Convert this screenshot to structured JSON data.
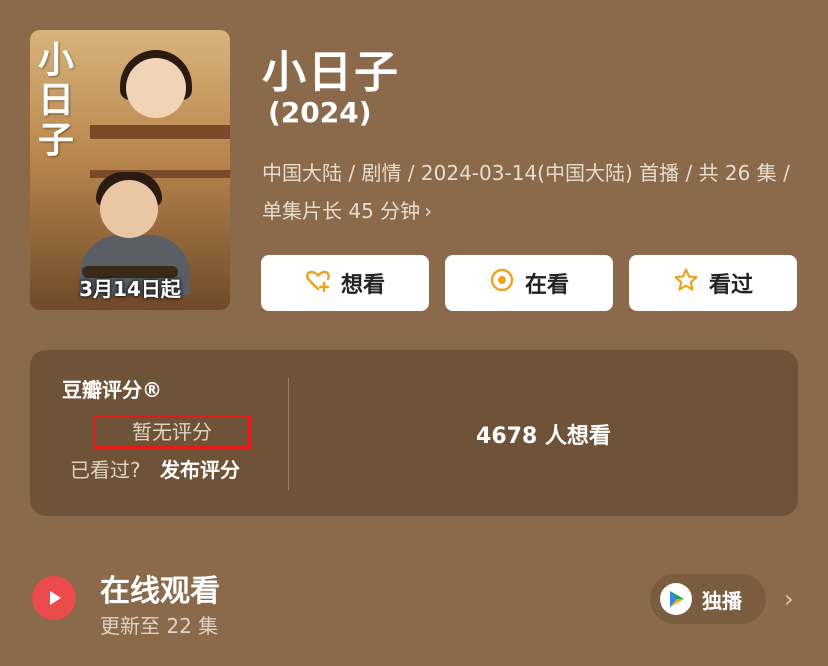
{
  "poster": {
    "calligraphy": "小日子",
    "date_text": "3月14日起"
  },
  "header": {
    "title": "小日子",
    "year": "(2024)",
    "meta_line": "中国大陆 / 剧情 / 2024-03-14(中国大陆) 首播 / 共 26 集 / 单集片长 45 分钟",
    "meta_chevron": "›"
  },
  "actions": [
    {
      "label": "想看",
      "icon": "heart-plus-icon"
    },
    {
      "label": "在看",
      "icon": "target-icon"
    },
    {
      "label": "看过",
      "icon": "star-icon"
    }
  ],
  "rating": {
    "label": "豆瓣评分®",
    "no_score": "暂无评分",
    "seen_prefix": "已看过?",
    "post_link": "发布评分",
    "wish_count_text": "4678 人想看"
  },
  "online": {
    "title": "在线观看",
    "subtitle": "更新至 22 集",
    "badge": "独播",
    "chevron": "›"
  },
  "colors": {
    "background": "#8a6a4a",
    "card": "#6e5338",
    "accent_red": "#ec4b4b",
    "highlight_box": "#e21b1b",
    "icon_orange": "#f0a020"
  }
}
